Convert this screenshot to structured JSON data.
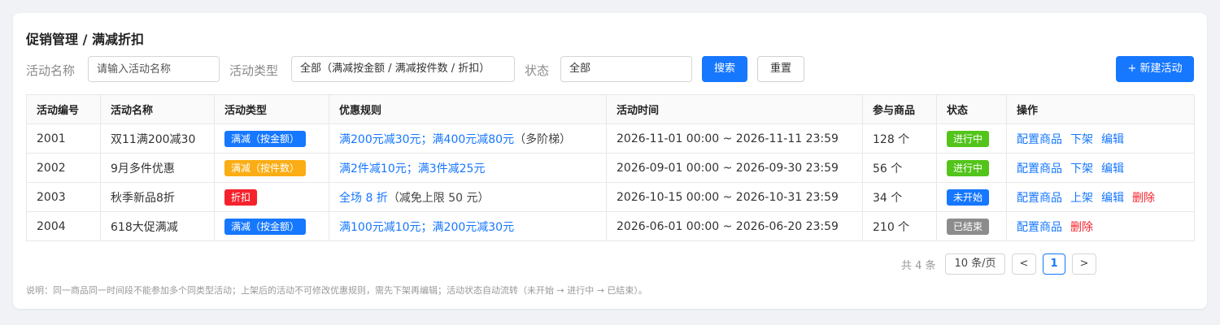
{
  "breadcrumb": "促销管理 / 满减折扣",
  "filters": {
    "name_label": "活动名称",
    "name_placeholder": "请输入活动名称",
    "type_label": "活动类型",
    "type_value": "全部（满减按金额 / 满减按件数 / 折扣）",
    "status_label": "状态",
    "status_value": "全部",
    "search_label": "搜索",
    "reset_label": "重置",
    "new_label": "+ 新建活动"
  },
  "table": {
    "columns": [
      "活动编号",
      "活动名称",
      "活动类型",
      "优惠规则",
      "活动时间",
      "参与商品",
      "状态",
      "操作"
    ],
    "rows": [
      {
        "id": "2001",
        "name": "双11满200减30",
        "type": {
          "label": "满减（按金额）",
          "color": "#1677ff"
        },
        "rule_link": "满200元减30元；满400元减80元",
        "rule_note": "（多阶梯）",
        "time": "2026-11-01 00:00 ~ 2026-11-11 23:59",
        "goods": "128 个",
        "status": {
          "label": "进行中",
          "color": "#52c41a"
        },
        "ops": [
          {
            "label": "配置商品",
            "danger": false
          },
          {
            "label": "下架",
            "danger": false
          },
          {
            "label": "编辑",
            "danger": false
          }
        ]
      },
      {
        "id": "2002",
        "name": "9月多件优惠",
        "type": {
          "label": "满减（按件数）",
          "color": "#faad14"
        },
        "rule_link": "满2件减10元；满3件减25元",
        "rule_note": "",
        "time": "2026-09-01 00:00 ~ 2026-09-30 23:59",
        "goods": "56 个",
        "status": {
          "label": "进行中",
          "color": "#52c41a"
        },
        "ops": [
          {
            "label": "配置商品",
            "danger": false
          },
          {
            "label": "下架",
            "danger": false
          },
          {
            "label": "编辑",
            "danger": false
          }
        ]
      },
      {
        "id": "2003",
        "name": "秋季新品8折",
        "type": {
          "label": "折扣",
          "color": "#f5222d"
        },
        "rule_link": "全场 8 折",
        "rule_note": "（减免上限 50 元）",
        "time": "2026-10-15 00:00 ~ 2026-10-31 23:59",
        "goods": "34 个",
        "status": {
          "label": "未开始",
          "color": "#1677ff"
        },
        "ops": [
          {
            "label": "配置商品",
            "danger": false
          },
          {
            "label": "上架",
            "danger": false
          },
          {
            "label": "编辑",
            "danger": false
          },
          {
            "label": "删除",
            "danger": true
          }
        ]
      },
      {
        "id": "2004",
        "name": "618大促满减",
        "type": {
          "label": "满减（按金额）",
          "color": "#1677ff"
        },
        "rule_link": "满100元减10元；满200元减30元",
        "rule_note": "",
        "time": "2026-06-01 00:00 ~ 2026-06-20 23:59",
        "goods": "210 个",
        "status": {
          "label": "已结束",
          "color": "#8c8c8c"
        },
        "ops": [
          {
            "label": "配置商品",
            "danger": false
          },
          {
            "label": "删除",
            "danger": true
          }
        ]
      }
    ]
  },
  "pagination": {
    "total": "共 4 条",
    "page_size": "10 条/页",
    "prev": "<",
    "current": "1",
    "next": ">"
  },
  "note": "说明：同一商品同一时间段不能参加多个同类型活动；上架后的活动不可修改优惠规则，需先下架再编辑；活动状态自动流转（未开始 → 进行中 → 已结束）。"
}
